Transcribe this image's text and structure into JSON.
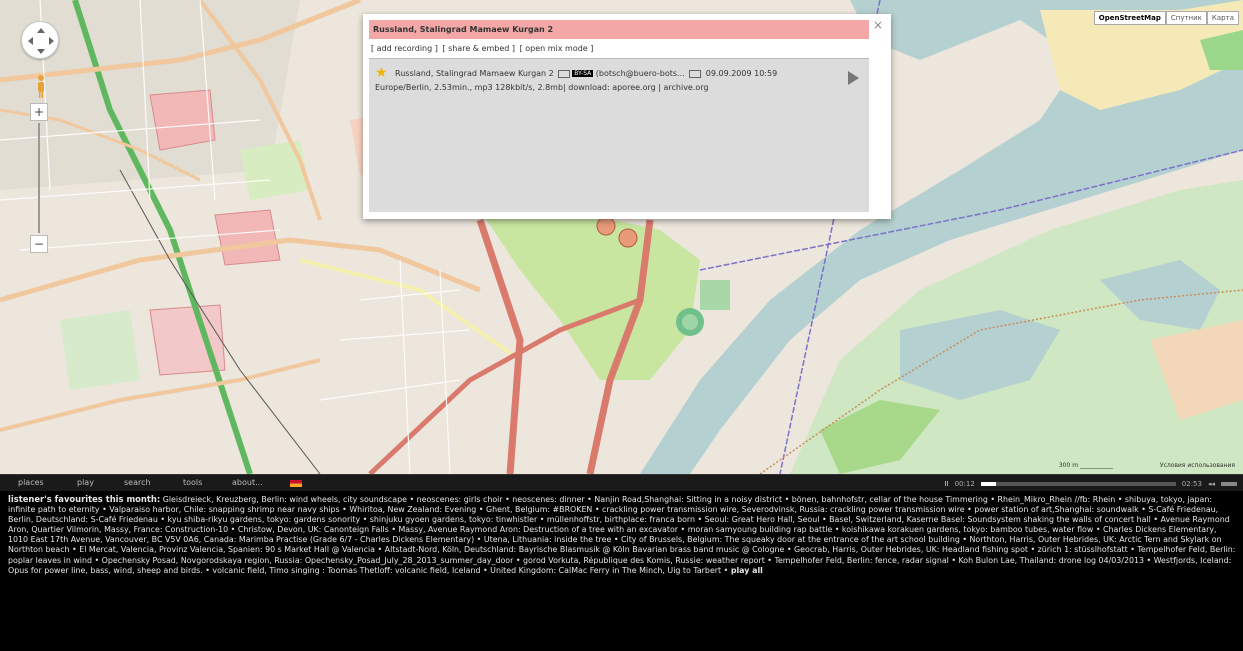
{
  "map": {
    "type_buttons": [
      "OpenStreetMap",
      "Спутник",
      "Карта"
    ],
    "active_type": "OpenStreetMap",
    "zoom_in": "+",
    "zoom_out": "−",
    "scale_label": "300 m",
    "attribution": "Условия использования"
  },
  "popup": {
    "title": "Russland, Stalingrad Mamaew Kurgan 2",
    "actions": [
      "[ add recording ]",
      "[ share & embed ]",
      "[ open mix mode ]"
    ],
    "close": "×",
    "recording": {
      "title": "Russland, Stalingrad Mamaew Kurgan 2",
      "license": "BY-SA",
      "author": "(botsch@buero-bots...",
      "date": "09.09.2009 10:59",
      "details": "Europe/Berlin, 2.53min., mp3 128kbit/s, 2.8mb| download: aporee.org | archive.org"
    }
  },
  "toolbar": {
    "nav": [
      "places",
      "play",
      "search",
      "tools",
      "about..."
    ],
    "pause_glyph": "II",
    "time_current": "00:12",
    "time_total": "02:53",
    "progress": 0.08,
    "volume_glyph": "◂◂"
  },
  "favourites": {
    "lead": "listener's favourites this month:",
    "text": "Gleisdreieck, Kreuzberg, Berlin: wind wheels, city soundscape • neoscenes: girls choir • neoscenes: dinner • Nanjin Road,Shanghai: Sitting in a noisy district • bönen, bahnhofstr, cellar of the house Timmering • Rhein_Mikro_Rhein //fb: Rhein • shibuya, tokyo, japan: infinite path to eternity • Valparaiso harbor, Chile: snapping shrimp near navy ships • Whiritoa, New Zealand: Evening • Ghent, Belgium: #BROKEN • crackling power transmission wire, Severodvinsk, Russia: crackling power transmission wire • power station of art,Shanghai: soundwalk • S-Café Friedenau, Berlin, Deutschland: S-Café Friedenau • kyu shiba-rikyu gardens, tokyo: gardens sonority • shinjuku gyoen gardens, tokyo: tinwhistler • müllenhoffstr, birthplace: franca born • Seoul: Great Hero Hall, Seoul • Basel, Switzerland, Kaserne Basel: Soundsystem shaking the walls of concert hall • Avenue Raymond Aron, Quartier Vilmorin, Massy, France: Construction-10 • Christow, Devon, UK: Canonteign Falls • Massy, Avenue Raymond Aron: Destruction of a tree with an excavator • moran samyoung building rap battle • koishikawa korakuen gardens, tokyo: bamboo tubes, water flow • Charles Dickens Elementary, 1010 East 17th Avenue, Vancouver, BC V5V 0A6, Canada: Marimba Practise (Grade 6/7 - Charles Dickens Elementary) • Utena, Lithuania: inside the tree • City of Brussels, Belgium: The squeaky door at the entrance of the art school building • Northton, Harris, Outer Hebrides, UK: Arctic Tern and Skylark on Northton beach • El Mercat, Valencia, Provinz Valencia, Spanien: 90 s Market Hall @ Valencia • Altstadt-Nord, Köln, Deutschland: Bayrische Blasmusik @ Köln Bavarian brass band music @ Cologne • Geocrab, Harris, Outer Hebrides, UK: Headland fishing spot • zürich 1: stüsslhofstatt • Tempelhofer Feld, Berlin: poplar leaves in wind • Opechensky Posad, Novgorodskaya region, Russia: Opechensky_Posad_July_28_2013_summer_day_door • gorod Vorkuta, République des Komis, Russie: weather report • Tempelhofer Feld, Berlin: fence, radar signal • Koh Bulon Lae, Thailand: drone log 04/03/2013 • Westfjords, Iceland: Opus for power line, bass, wind, sheep and birds. • volcanic field, Timo singing : Toomas Thetloff: volcanic field, Iceland • United Kingdom: CalMac Ferry in The Minch, Uig to Tarbert •",
    "play_all": "play all"
  },
  "colors": {
    "popup_title_bg": "#f3a7a7",
    "river": "#b5d0d0",
    "park": "#c8e6a0",
    "road_major": "#d97a6c",
    "road_green": "#5fb85f"
  }
}
